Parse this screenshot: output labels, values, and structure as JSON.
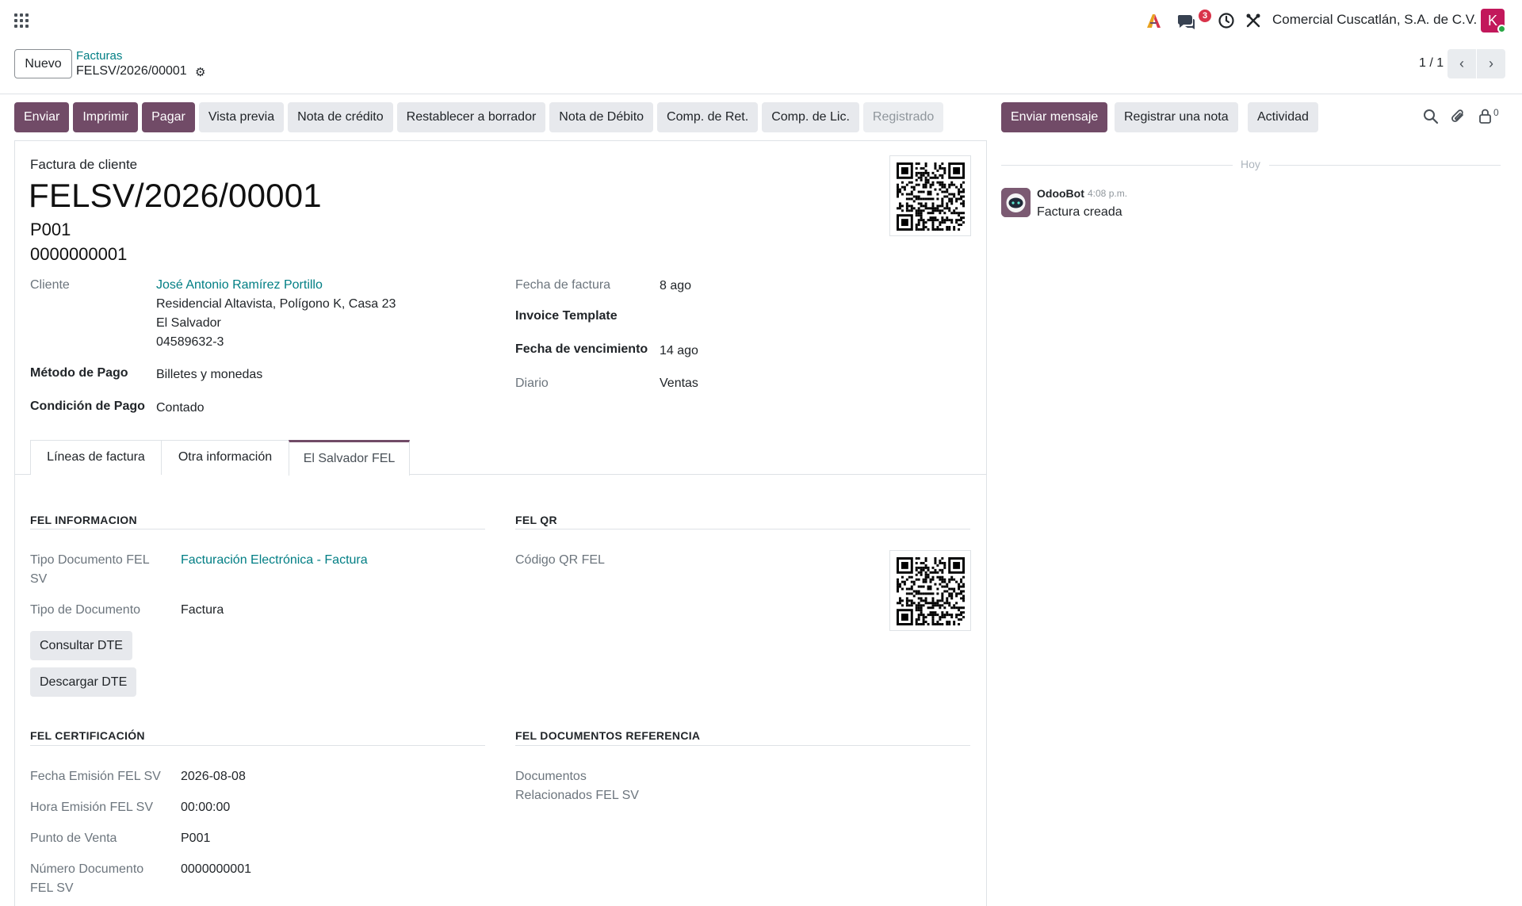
{
  "navbar": {
    "badge_count": "3",
    "company": "Comercial Cuscatlán, S.A. de C.V.",
    "avatar_letter": "K"
  },
  "control_panel": {
    "new_label": "Nuevo",
    "breadcrumb_parent": "Facturas",
    "breadcrumb_current": "FELSV/2026/00001",
    "pager": "1 / 1"
  },
  "actions": {
    "send": "Enviar",
    "print": "Imprimir",
    "pay": "Pagar",
    "preview": "Vista previa",
    "credit_note": "Nota de crédito",
    "reset_draft": "Restablecer a borrador",
    "debit_note": "Nota de Débito",
    "comp_ret": "Comp. de Ret.",
    "comp_lic": "Comp. de Lic.",
    "status": "Registrado"
  },
  "invoice": {
    "type_label": "Factura de cliente",
    "name": "FELSV/2026/00001",
    "sub1": "P001",
    "sub2": "0000000001",
    "customer_label": "Cliente",
    "customer_name": "José Antonio Ramírez Portillo",
    "customer_addr1": "Residencial Altavista, Polígono K, Casa 23",
    "customer_addr2": "El Salvador",
    "customer_vat": "04589632-3",
    "payment_method_label": "Método de Pago",
    "payment_method": "Billetes y monedas",
    "payment_cond_label": "Condición de Pago",
    "payment_cond": "Contado",
    "invoice_date_label": "Fecha de factura",
    "invoice_date": "8 ago",
    "template_label": "Invoice Template",
    "due_date_label": "Fecha de vencimiento",
    "due_date": "14 ago",
    "journal_label": "Diario",
    "journal": "Ventas"
  },
  "tabs": {
    "lines": "Líneas de factura",
    "other": "Otra información",
    "fel": "El Salvador FEL"
  },
  "fel": {
    "info_title": "FEL INFORMACION",
    "doc_type_fel_label_1": "Tipo Documento FEL",
    "doc_type_fel_label_2": "SV",
    "doc_type_fel": "Facturación Electrónica - Factura",
    "doc_type_label": "Tipo de Documento",
    "doc_type": "Factura",
    "consult_btn": "Consultar DTE",
    "download_btn": "Descargar DTE",
    "qr_title": "FEL QR",
    "qr_label": "Código QR FEL",
    "cert_title": "FEL CERTIFICACIÓN",
    "emit_date_label": "Fecha Emisión FEL SV",
    "emit_date": "2026-08-08",
    "emit_time_label": "Hora Emisión FEL SV",
    "emit_time": "00:00:00",
    "pos_label": "Punto de Venta",
    "pos": "P001",
    "doc_number_label_1": "Número Documento",
    "doc_number_label_2": "FEL SV",
    "doc_number": "0000000001",
    "ref_title": "FEL DOCUMENTOS REFERENCIA",
    "ref_label_1": "Documentos",
    "ref_label_2": "Relacionados FEL SV"
  },
  "chatter": {
    "send_message": "Enviar mensaje",
    "log_note": "Registrar una nota",
    "activity": "Actividad",
    "followers_count": "0",
    "today": "Hoy",
    "author": "OdooBot",
    "time": "4:08 p.m.",
    "message": "Factura creada"
  },
  "colors": {
    "brand": "#714b67",
    "link": "#017e84",
    "badge": "#d9334a",
    "avatar": "#c2185b"
  }
}
